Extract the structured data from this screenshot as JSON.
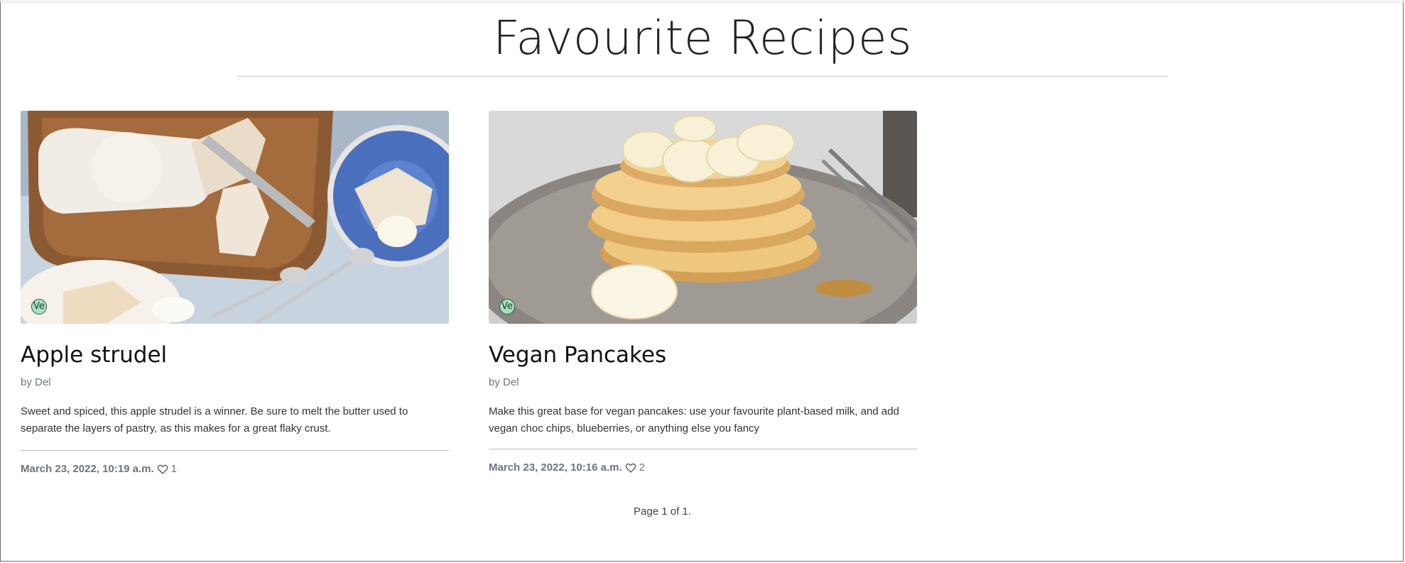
{
  "header": {
    "title": "Favourite Recipes"
  },
  "recipes": [
    {
      "title": "Apple strudel",
      "author": "by Del",
      "description": "Sweet and spiced, this apple strudel is a winner. Be sure to melt the butter used to separate the layers of pastry, as this makes for a great flaky crust.",
      "date": "March 23, 2022, 10:19 a.m.",
      "likes": "1",
      "diet_badge": "Ve",
      "icon": "heart-outline-icon"
    },
    {
      "title": "Vegan Pancakes",
      "author": "by Del",
      "description": "Make this great base for vegan pancakes: use your favourite plant-based milk, and add vegan choc chips, blueberries, or anything else you fancy",
      "date": "March 23, 2022, 10:16 a.m.",
      "likes": "2",
      "diet_badge": "Ve",
      "icon": "heart-outline-icon"
    }
  ],
  "pagination": {
    "text": "Page 1 of 1."
  },
  "colors": {
    "badge_fill": "#a8e0bf",
    "badge_border": "#2e5c45",
    "muted_text": "#6c757d"
  }
}
